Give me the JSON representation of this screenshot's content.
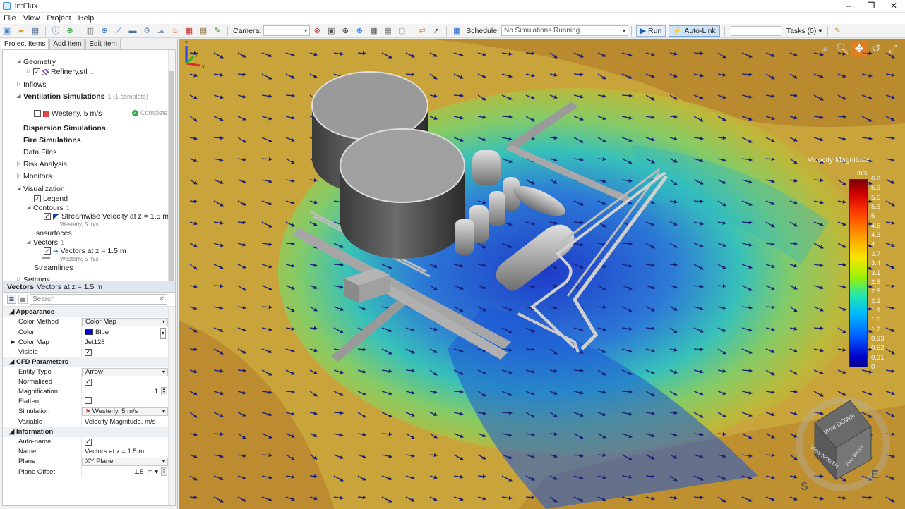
{
  "app": {
    "title": "in:Flux"
  },
  "menu": [
    "File",
    "View",
    "Project",
    "Help"
  ],
  "toolbar": {
    "camera_label": "Camera:",
    "schedule_label": "Schedule:",
    "schedule_value": "No Simulations Running",
    "run_label": "Run",
    "autolink_label": "Auto-Link",
    "tasks_label": "Tasks (0)"
  },
  "tabs": [
    "Project Items",
    "Add Item",
    "Edit Item"
  ],
  "tree": {
    "geometry": "Geometry",
    "refinery": "Refinery.stl",
    "refinery_count": "1",
    "inflows": "Inflows",
    "ventilation": "Ventilation Simulations",
    "ventilation_meta": "1 (1 complete)",
    "westerly": "Westerly, 5 m/s",
    "complete": "Complete",
    "dispersion": "Dispersion Simulations",
    "fire": "Fire Simulations",
    "data_files": "Data Files",
    "risk": "Risk Analysis",
    "monitors": "Monitors",
    "visualization": "Visualization",
    "legend": "Legend",
    "contours": "Contours",
    "contours_count": "1",
    "streamwise": "Streamwise Velocity at z = 1.5 m",
    "streamwise_sub": "Westerly, 5 m/s",
    "isosurfaces": "Isosurfaces",
    "vectors": "Vectors",
    "vectors_count": "1",
    "vectors_item": "Vectors at z = 1.5 m",
    "vectors_sub": "Westerly, 5 m/s",
    "streamlines": "Streamlines",
    "settings": "Settings"
  },
  "props": {
    "header_type": "Vectors",
    "header_name": "Vectors at z = 1.5 m",
    "search_placeholder": "Search",
    "sections": {
      "appearance": "Appearance",
      "cfd": "CFD Parameters",
      "information": "Information"
    },
    "rows": {
      "color_method": {
        "name": "Color Method",
        "value": "Color Map"
      },
      "color": {
        "name": "Color",
        "value": "Blue"
      },
      "color_map": {
        "name": "Color Map",
        "value": "Jet128"
      },
      "visible": {
        "name": "Visible",
        "value": "✓"
      },
      "entity_type": {
        "name": "Entity Type",
        "value": "Arrow"
      },
      "normalized": {
        "name": "Normalized",
        "value": "✓"
      },
      "magnification": {
        "name": "Magnification",
        "value": "1"
      },
      "flatten": {
        "name": "Flatten",
        "value": ""
      },
      "simulation": {
        "name": "Simulation",
        "value": "Westerly, 5 m/s"
      },
      "variable": {
        "name": "Variable",
        "value": "Velocity Magnitude, m/s"
      },
      "auto_name": {
        "name": "Auto-name",
        "value": "✓"
      },
      "name": {
        "name": "Name",
        "value": "Vectors at z = 1.5 m"
      },
      "plane": {
        "name": "Plane",
        "value": "XY Plane"
      },
      "plane_offset": {
        "name": "Plane Offset",
        "value": "1.5",
        "unit": "m"
      }
    }
  },
  "legend": {
    "title": "Velocity Magnitude",
    "unit": "m/s",
    "ticks": [
      "6.2",
      "5.9",
      "5.6",
      "5.3",
      "5",
      "4.6",
      "4.3",
      "4",
      "3.7",
      "3.4",
      "3.1",
      "2.8",
      "2.5",
      "2.2",
      "1.9",
      "1.6",
      "1.2",
      "0.93",
      "0.62",
      "0.31",
      "0"
    ]
  },
  "view_cube": {
    "top": "View DOWN",
    "front": "View NORTH",
    "side": "View WEST",
    "compass_s": "S",
    "compass_e": "E"
  },
  "axes": {
    "x": "x",
    "y": "y",
    "z": "z"
  },
  "colors": {
    "ground": "#c8a43a",
    "accent": "#3c8fd6"
  }
}
